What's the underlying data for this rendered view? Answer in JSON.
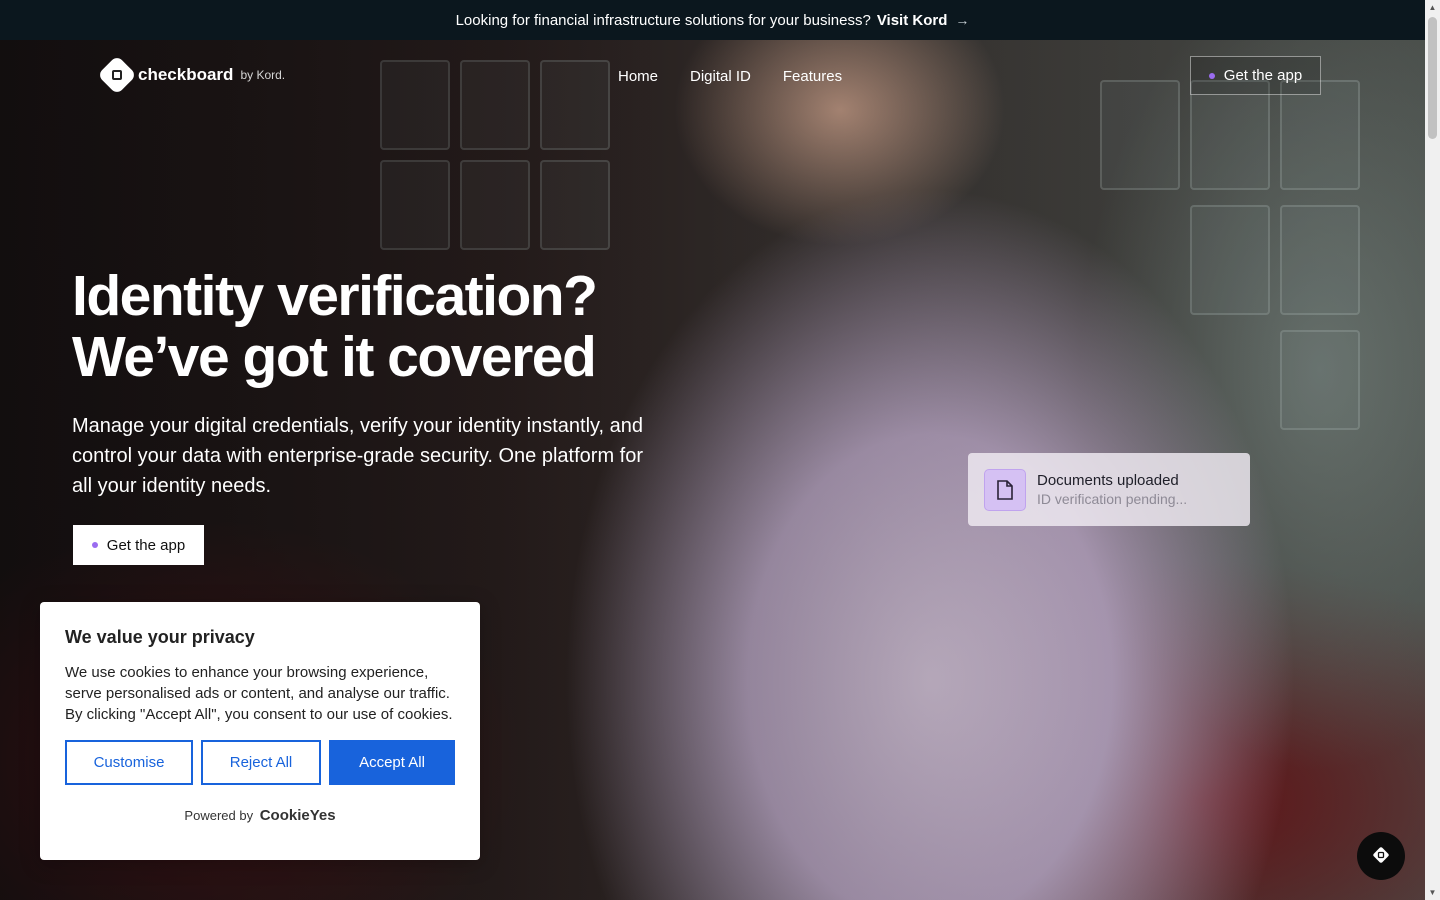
{
  "announcement": {
    "text": "Looking for financial infrastructure solutions for your business?",
    "link_label": "Visit Kord",
    "arrow": "→"
  },
  "brand": {
    "name": "checkboard",
    "byline": "by Kord."
  },
  "nav": {
    "links": [
      {
        "label": "Home"
      },
      {
        "label": "Digital ID"
      },
      {
        "label": "Features"
      }
    ],
    "cta_label": "Get the app"
  },
  "hero": {
    "headline_line1": "Identity verification?",
    "headline_line2": "We’ve got it covered",
    "subtext": "Manage your digital credentials, verify your identity instantly, and control your data with enterprise-grade security. One platform for all your identity needs.",
    "cta_label": "Get the app"
  },
  "status_card": {
    "title": "Documents uploaded",
    "subtitle": "ID verification pending..."
  },
  "cookie_banner": {
    "title": "We value your privacy",
    "body": "We use cookies to enhance your browsing experience, serve personalised ads or content, and analyse our traffic. By clicking \"Accept All\", you consent to our use of cookies.",
    "customise_label": "Customise",
    "reject_label": "Reject All",
    "accept_label": "Accept All",
    "powered_by": "Powered by",
    "powered_brand": "CookieYes"
  },
  "colors": {
    "accent_dot": "#9a6cf0",
    "cookie_primary": "#1863dc",
    "announce_bg": "#0b171e"
  },
  "icons": {
    "brand_logo": "checkboard-logo-icon",
    "status": "document-icon",
    "chat": "chat-launcher-icon"
  }
}
